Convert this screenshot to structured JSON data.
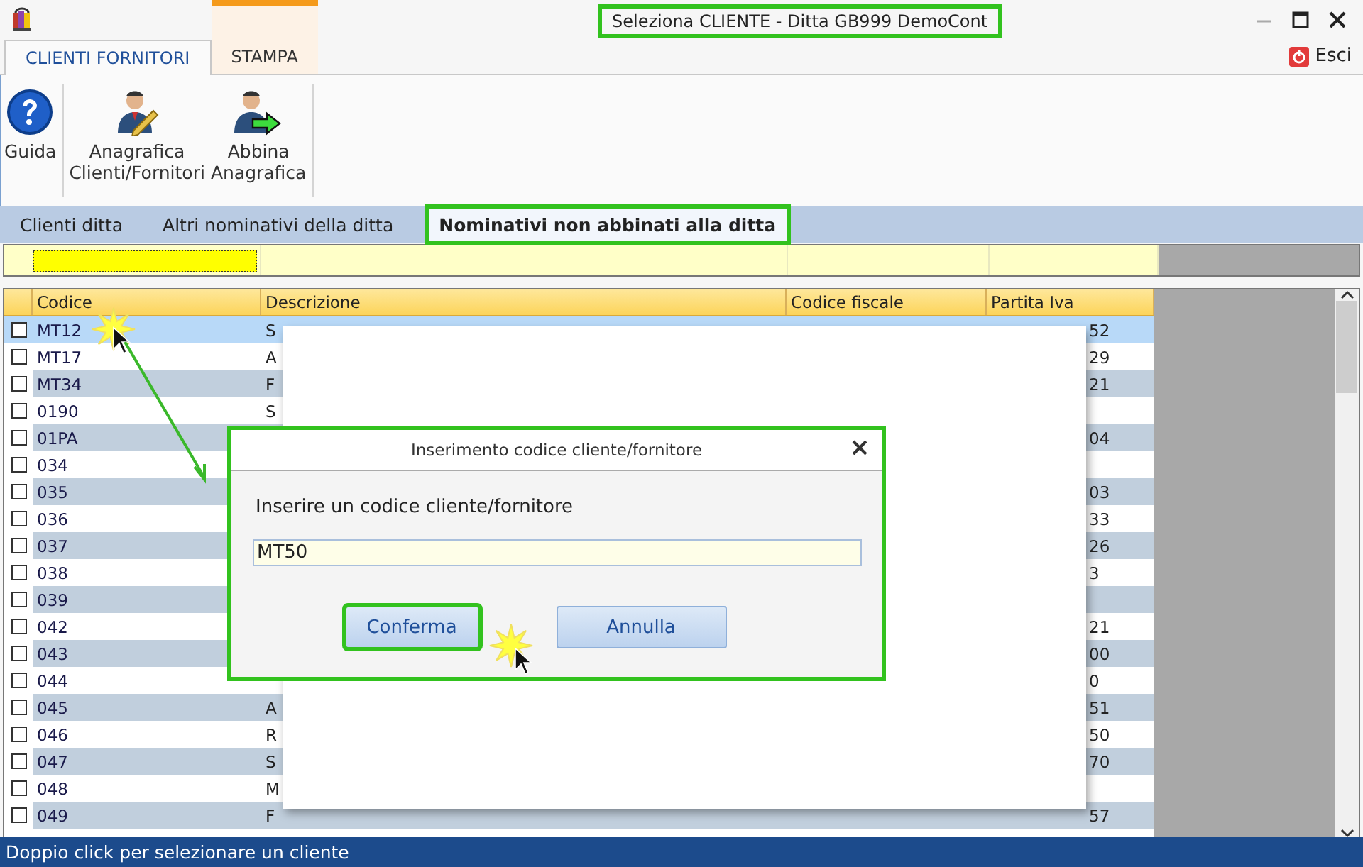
{
  "window": {
    "title": "Seleziona CLIENTE  - Ditta GB999 DemoCont",
    "title_callout": true
  },
  "ribbon_tabs": [
    {
      "label": "CLIENTI FORNITORI",
      "selected": true,
      "highlighted": false
    },
    {
      "label": "STAMPA",
      "selected": false,
      "highlighted": true
    }
  ],
  "exit_button": "Esci",
  "ribbon_buttons": [
    {
      "kind": "help",
      "lines": [
        "Guida"
      ]
    },
    {
      "kind": "edit",
      "lines": [
        "Anagrafica",
        "Clienti/Fornitori"
      ]
    },
    {
      "kind": "link",
      "lines": [
        "Abbina",
        "Anagrafica"
      ]
    }
  ],
  "view_tabs": [
    {
      "label": "Clienti ditta",
      "selected": false,
      "callout": false
    },
    {
      "label": "Altri nominativi della ditta",
      "selected": false,
      "callout": false
    },
    {
      "label": "Nominativi non abbinati alla ditta",
      "selected": true,
      "callout": true
    }
  ],
  "table": {
    "columns": [
      "Codice",
      "Descrizione",
      "Codice fiscale",
      "Partita Iva"
    ],
    "rows": [
      {
        "code": "MT12",
        "description": "S",
        "partita_iva": "52",
        "checked": false,
        "selected": true
      },
      {
        "code": "MT17",
        "description": "A",
        "partita_iva": "29",
        "checked": false,
        "selected": false
      },
      {
        "code": "MT34",
        "description": "F",
        "partita_iva": "21",
        "checked": false,
        "selected": false
      },
      {
        "code": "0190",
        "description": "S",
        "checked": false,
        "selected": false
      },
      {
        "code": "01PA",
        "partita_iva": "04",
        "checked": false,
        "selected": false
      },
      {
        "code": "034",
        "checked": false,
        "selected": false
      },
      {
        "code": "035",
        "partita_iva": "03",
        "checked": false,
        "selected": false
      },
      {
        "code": "036",
        "partita_iva": "33",
        "checked": false,
        "selected": false
      },
      {
        "code": "037",
        "partita_iva": "26",
        "checked": false,
        "selected": false
      },
      {
        "code": "038",
        "partita_iva": "3",
        "checked": false,
        "selected": false
      },
      {
        "code": "039",
        "checked": false,
        "selected": false
      },
      {
        "code": "042",
        "partita_iva": "21",
        "checked": false,
        "selected": false
      },
      {
        "code": "043",
        "partita_iva": "00",
        "checked": false,
        "selected": false
      },
      {
        "code": "044",
        "partita_iva": "0",
        "checked": false,
        "selected": false
      },
      {
        "code": "045",
        "description": "A",
        "partita_iva": "51",
        "checked": false,
        "selected": false
      },
      {
        "code": "046",
        "description": "R",
        "partita_iva": "50",
        "checked": false,
        "selected": false
      },
      {
        "code": "047",
        "description": "S",
        "partita_iva": "70",
        "checked": false,
        "selected": false
      },
      {
        "code": "048",
        "description": "M",
        "checked": false,
        "selected": false
      },
      {
        "code": "049",
        "description": "F",
        "partita_iva": "57",
        "checked": false,
        "selected": false
      }
    ]
  },
  "dialog": {
    "title": "Inserimento codice cliente/fornitore",
    "prompt": "Inserire un codice cliente/fornitore",
    "value": "MT50",
    "callout": true,
    "buttons": [
      {
        "label": "Conferma",
        "callout": true
      },
      {
        "label": "Annulla",
        "callout": false
      }
    ]
  },
  "status_bar": "Doppio click per selezionare un cliente"
}
